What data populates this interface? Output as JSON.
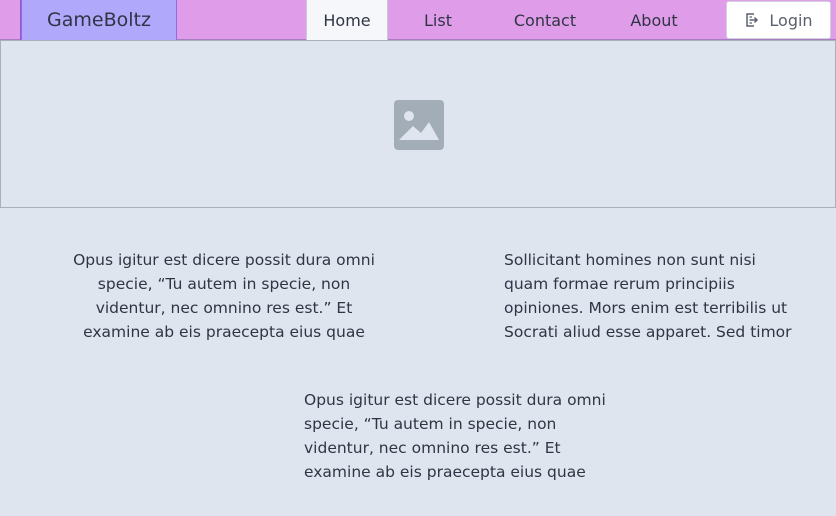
{
  "brand": {
    "name": "GameBoltz"
  },
  "nav": {
    "items": [
      {
        "label": "Home",
        "active": true
      },
      {
        "label": "List",
        "active": false
      },
      {
        "label": "Contact",
        "active": false
      },
      {
        "label": "About",
        "active": false
      }
    ],
    "login_label": "Login"
  },
  "hero": {
    "icon": "image-placeholder-icon"
  },
  "content": {
    "paragraphs": [
      "Opus igitur est dicere possit dura omni specie, “Tu autem in specie, non videntur, nec omnino res est.” Et examine ab eis praecepta eius quae",
      "Sollicitant homines non sunt nisi quam formae rerum principiis opiniones. Mors enim est terribilis ut Socrati aliud esse apparet. Sed timor",
      "Opus igitur est dicere possit dura omni specie, “Tu autem in specie, non videntur, nec omnino res est.” Et examine ab eis praecepta eius quae"
    ]
  },
  "colors": {
    "navbar_bg": "#df9ce8",
    "brand_bg": "#b0a8fb",
    "page_bg": "#dfe5ee",
    "icon_gray": "#a3adb8"
  }
}
